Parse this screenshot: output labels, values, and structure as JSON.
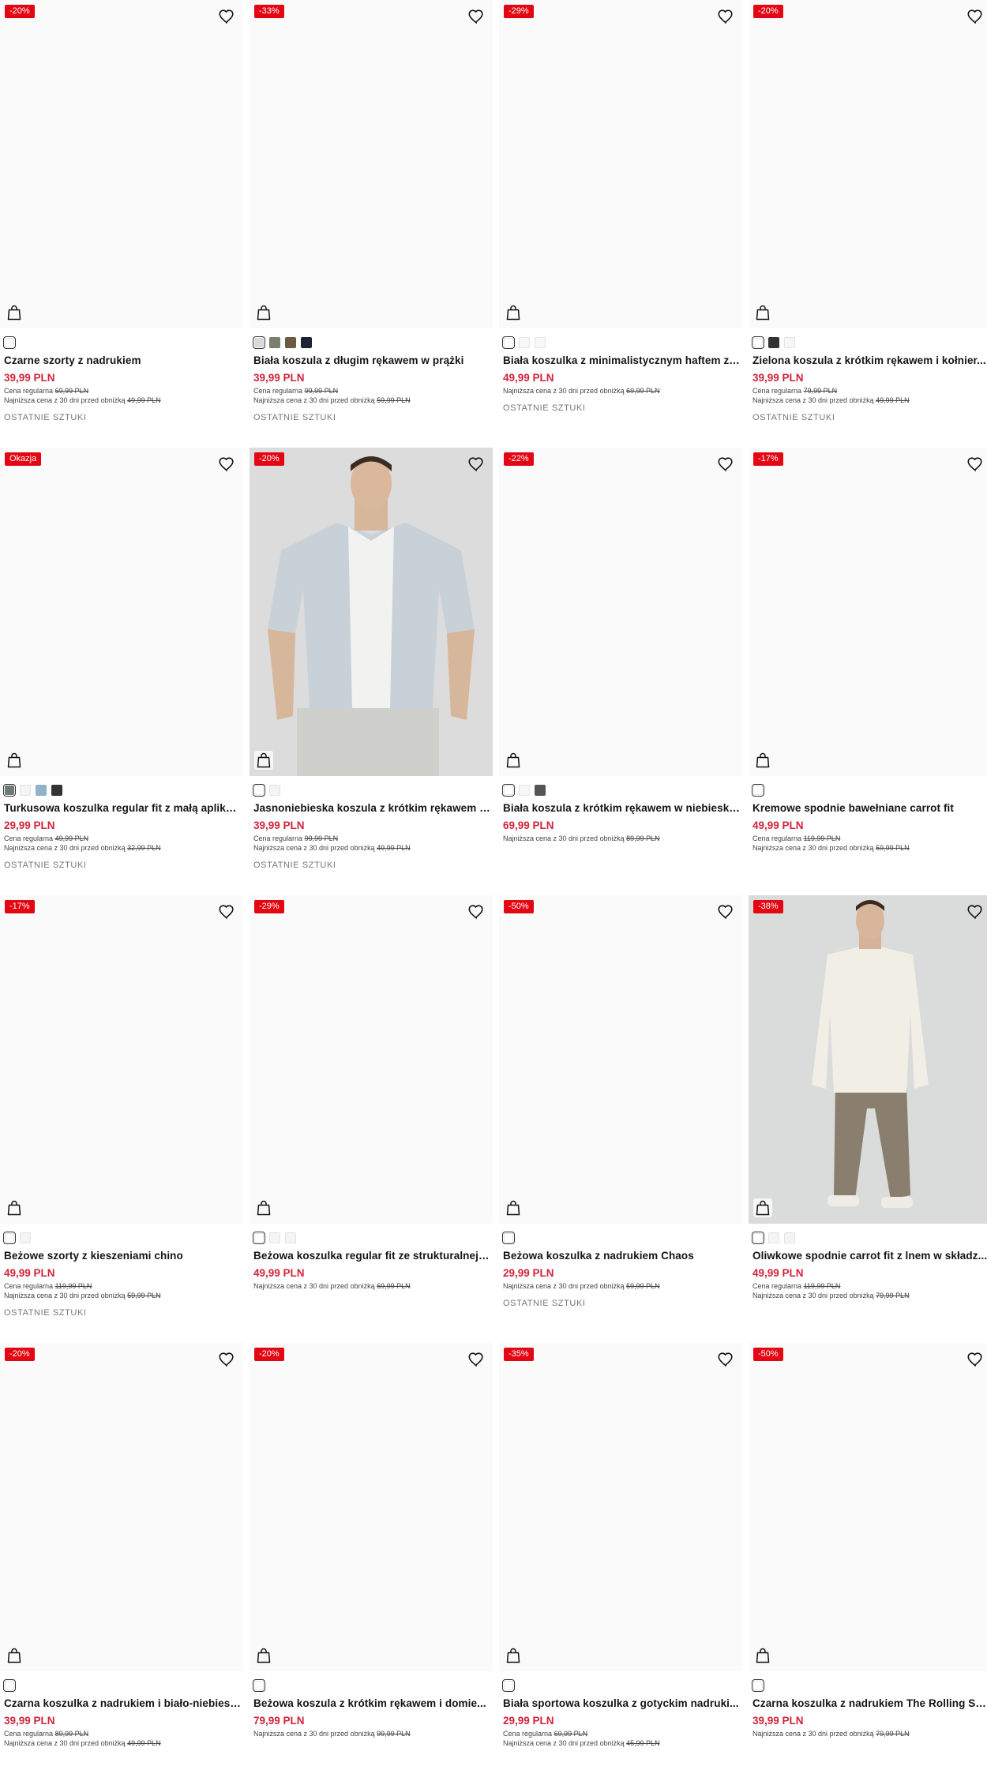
{
  "products": [
    {
      "badge": "-20%",
      "name": "Czarne szorty z nadrukiem",
      "price": "39,99 PLN",
      "regular_label": "Cena regularna",
      "regular_price": "69,99 PLN",
      "lowest_label": "Najniższa cena z 30 dni przed obniżką",
      "lowest_price": "49,99 PLN",
      "status": "OSTATNIE SZTUKI",
      "swatches": [
        "#ffffff"
      ]
    },
    {
      "badge": "-33%",
      "name": "Biała koszula z długim rękawem w prążki",
      "price": "39,99 PLN",
      "regular_label": "Cena regularna",
      "regular_price": "99,99 PLN",
      "lowest_label": "Najniższa cena z 30 dni przed obniżką",
      "lowest_price": "59,99 PLN",
      "status": "OSTATNIE SZTUKI",
      "swatches": [
        "#d9d9d6",
        "#7a7f6e",
        "#6b5a44",
        "#1c2333"
      ]
    },
    {
      "badge": "-29%",
      "name": "Biała koszulka z minimalistycznym haftem z ...",
      "price": "49,99 PLN",
      "regular_label": "",
      "regular_price": "",
      "lowest_label": "Najniższa cena z 30 dni przed obniżką",
      "lowest_price": "69,99 PLN",
      "status": "OSTATNIE SZTUKI",
      "swatches": [
        "#ffffff",
        "#f7f7f7",
        "#f7f7f7"
      ]
    },
    {
      "badge": "-20%",
      "name": "Zielona koszula z krótkim rękawem i kołnier...",
      "price": "39,99 PLN",
      "regular_label": "Cena regularna",
      "regular_price": "79,99 PLN",
      "lowest_label": "Najniższa cena z 30 dni przed obniżką",
      "lowest_price": "49,99 PLN",
      "status": "OSTATNIE SZTUKI",
      "swatches": [
        "#ffffff",
        "#333333",
        "#f7f7f7"
      ]
    },
    {
      "badge": "Okazja",
      "name": "Turkusowa koszulka regular fit z małą aplika...",
      "price": "29,99 PLN",
      "regular_label": "Cena regularna",
      "regular_price": "49,99 PLN",
      "lowest_label": "Najniższa cena z 30 dni przed obniżką",
      "lowest_price": "32,99 PLN",
      "status": "OSTATNIE SZTUKI",
      "swatches": [
        "#6f7a74",
        "#f4f4f4",
        "#8fb3c9",
        "#333333"
      ]
    },
    {
      "badge": "-20%",
      "name": "Jasnoniebieska koszula z krótkim rękawem z...",
      "price": "39,99 PLN",
      "regular_label": "Cena regularna",
      "regular_price": "99,99 PLN",
      "lowest_label": "Najniższa cena z 30 dni przed obniżką",
      "lowest_price": "49,99 PLN",
      "status": "OSTATNIE SZTUKI",
      "swatches": [
        "#ffffff",
        "#f4f4f4"
      ]
    },
    {
      "badge": "-22%",
      "name": "Biała koszula z krótkim rękawem w niebieski...",
      "price": "69,99 PLN",
      "regular_label": "",
      "regular_price": "",
      "lowest_label": "Najniższa cena z 30 dni przed obniżką",
      "lowest_price": "89,99 PLN",
      "status": "",
      "swatches": [
        "#ffffff",
        "#f7f7f7",
        "#555555"
      ]
    },
    {
      "badge": "-17%",
      "name": "Kremowe spodnie bawełniane carrot fit",
      "price": "49,99 PLN",
      "regular_label": "Cena regularna",
      "regular_price": "119,99 PLN",
      "lowest_label": "Najniższa cena z 30 dni przed obniżką",
      "lowest_price": "59,99 PLN",
      "status": "",
      "swatches": [
        "#ffffff"
      ]
    },
    {
      "badge": "-17%",
      "name": "Beżowe szorty z kieszeniami chino",
      "price": "49,99 PLN",
      "regular_label": "Cena regularna",
      "regular_price": "119,99 PLN",
      "lowest_label": "Najniższa cena z 30 dni przed obniżką",
      "lowest_price": "59,99 PLN",
      "status": "OSTATNIE SZTUKI",
      "swatches": [
        "#ffffff",
        "#f4f4f4"
      ]
    },
    {
      "badge": "-29%",
      "name": "Beżowa koszulka regular fit ze strukturalnej ...",
      "price": "49,99 PLN",
      "regular_label": "",
      "regular_price": "",
      "lowest_label": "Najniższa cena z 30 dni przed obniżką",
      "lowest_price": "69,99 PLN",
      "status": "",
      "swatches": [
        "#ffffff",
        "#f4f4f4",
        "#f4f4f4"
      ]
    },
    {
      "badge": "-50%",
      "name": "Beżowa koszulka z nadrukiem Chaos",
      "price": "29,99 PLN",
      "regular_label": "",
      "regular_price": "",
      "lowest_label": "Najniższa cena z 30 dni przed obniżką",
      "lowest_price": "59,99 PLN",
      "status": "OSTATNIE SZTUKI",
      "swatches": [
        "#ffffff"
      ]
    },
    {
      "badge": "-38%",
      "name": "Oliwkowe spodnie carrot fit z lnem w składz...",
      "price": "49,99 PLN",
      "regular_label": "Cena regularna",
      "regular_price": "119,99 PLN",
      "lowest_label": "Najniższa cena z 30 dni przed obniżką",
      "lowest_price": "79,99 PLN",
      "status": "",
      "swatches": [
        "#ffffff",
        "#f4f4f4",
        "#f4f4f4"
      ]
    },
    {
      "badge": "-20%",
      "name": "Czarna koszulka z nadrukiem i biało-niebiesk...",
      "price": "39,99 PLN",
      "regular_label": "Cena regularna",
      "regular_price": "89,99 PLN",
      "lowest_label": "Najniższa cena z 30 dni przed obniżką",
      "lowest_price": "49,99 PLN",
      "status": "",
      "swatches": [
        "#ffffff"
      ]
    },
    {
      "badge": "-20%",
      "name": "Beżowa koszula z krótkim rękawem i domie...",
      "price": "79,99 PLN",
      "regular_label": "",
      "regular_price": "",
      "lowest_label": "Najniższa cena z 30 dni przed obniżką",
      "lowest_price": "99,99 PLN",
      "status": "",
      "swatches": [
        "#ffffff"
      ]
    },
    {
      "badge": "-35%",
      "name": "Biała sportowa koszulka z gotyckim nadruki...",
      "price": "29,99 PLN",
      "regular_label": "Cena regularna",
      "regular_price": "69,99 PLN",
      "lowest_label": "Najniższa cena z 30 dni przed obniżką",
      "lowest_price": "45,99 PLN",
      "status": "",
      "swatches": [
        "#ffffff"
      ]
    },
    {
      "badge": "-50%",
      "name": "Czarna koszulka z nadrukiem The Rolling Sto...",
      "price": "39,99 PLN",
      "regular_label": "",
      "regular_price": "",
      "lowest_label": "Najniższa cena z 30 dni przed obniżką",
      "lowest_price": "79,99 PLN",
      "status": "",
      "swatches": [
        "#ffffff"
      ]
    }
  ],
  "icons": {
    "favorite": "heart-icon",
    "cart": "shopping-bag-icon"
  },
  "colors": {
    "badge": "#e30613",
    "price": "#d0243b"
  }
}
